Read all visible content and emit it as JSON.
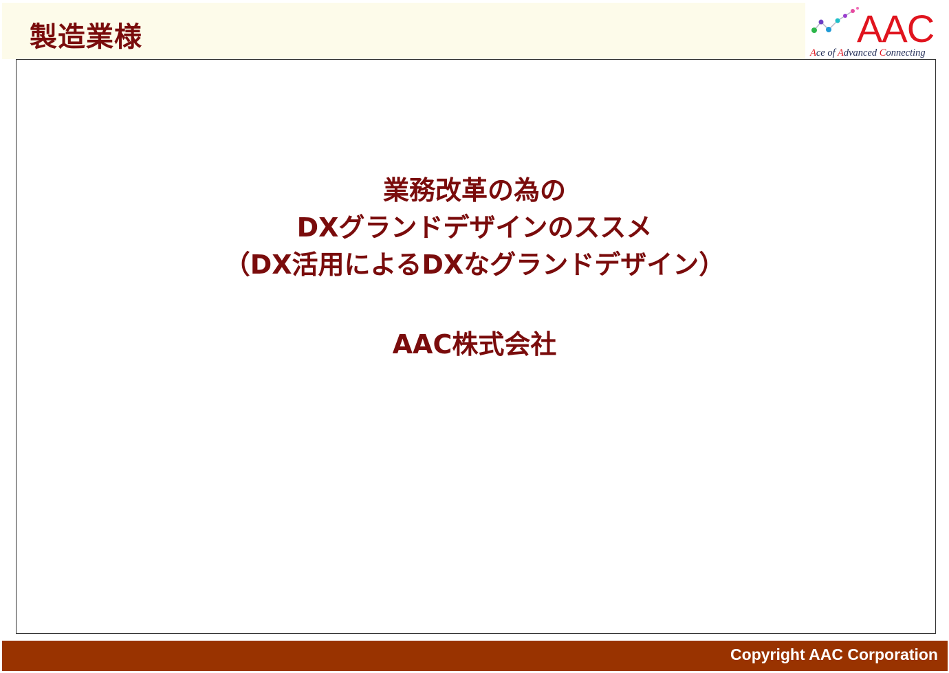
{
  "header": {
    "title": "製造業様"
  },
  "logo": {
    "mark": "AAC",
    "tagline_parts": [
      {
        "text": "A",
        "highlight": true
      },
      {
        "text": "ce of ",
        "highlight": false
      },
      {
        "text": "A",
        "highlight": true
      },
      {
        "text": "dvanced ",
        "highlight": false
      },
      {
        "text": "C",
        "highlight": true
      },
      {
        "text": "onnecting",
        "highlight": false
      }
    ],
    "colors": {
      "mark": "#e0141e",
      "tagline": "#1f2a55",
      "tagline_highlight": "#e0141e"
    }
  },
  "document": {
    "title_lines": [
      "業務改革の為の",
      "DXグランドデザインのススメ",
      "（DX活用によるDXなグランドデザイン）"
    ],
    "company": "AAC株式会社"
  },
  "footer": {
    "copyright": "Copyright AAC Corporation"
  },
  "colors": {
    "accent": "#7a0c0c",
    "footer_bg": "#993300",
    "header_bg": "#fdfbea"
  }
}
